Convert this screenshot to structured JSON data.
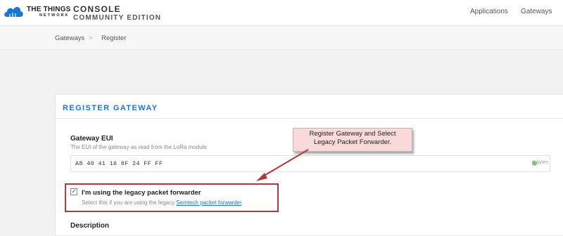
{
  "header": {
    "brand_line1": "THE THINGS",
    "brand_line2": "NETWORK",
    "console_line1": "CONSOLE",
    "console_line2": "COMMUNITY EDITION",
    "nav": [
      {
        "label": "Applications"
      },
      {
        "label": "Gateways"
      }
    ],
    "logo_icon": "cloud-icon",
    "logo_color": "#1976d2"
  },
  "breadcrumb": {
    "items": [
      "Gateways",
      "Register"
    ],
    "separator": ">"
  },
  "card": {
    "title": "REGISTER GATEWAY",
    "title_color": "#1976d2",
    "eui": {
      "label": "Gateway EUI",
      "description": "The EUI of the gateway as read from the LoRa module",
      "value": "A8  40  41  16  8F  24  FF  FF",
      "bytes": "8 bytes",
      "status_color": "#7ccc7c"
    },
    "legacy": {
      "checked": true,
      "label": "I'm using the legacy packet forwarder",
      "description_prefix": "Select this if you are using the legacy ",
      "link_text": "Semtech packet forwarder",
      "description_suffix": "."
    },
    "description_heading": "Description"
  },
  "annotation": {
    "callout_text_line1": "Register  Gateway and Select",
    "callout_text_line2": "Legacy Packet Forwarder.",
    "box_color": "#b0393b"
  }
}
